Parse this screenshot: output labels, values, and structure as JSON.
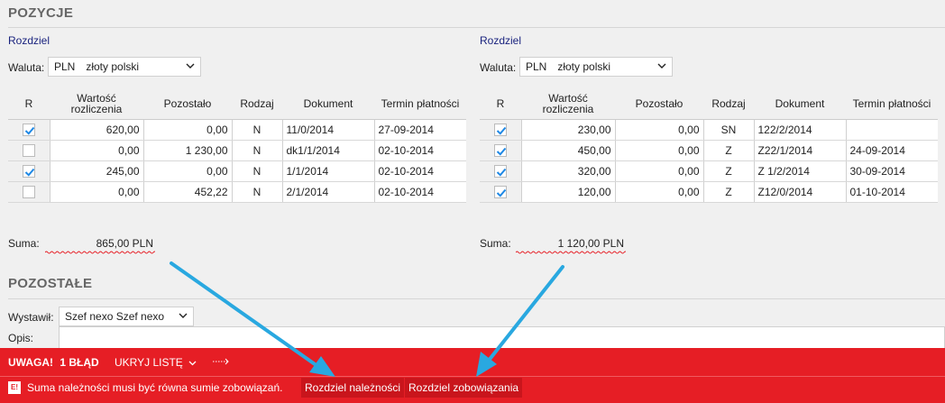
{
  "sections": {
    "pozycje": "POZYCJE",
    "pozostale": "POZOSTAŁE"
  },
  "left": {
    "link": "Rozdziel",
    "currency_label": "Waluta:",
    "currency_code": "PLN",
    "currency_name": "złoty polski",
    "columns": [
      "R",
      "Wartość rozliczenia",
      "Pozostało",
      "Rodzaj",
      "Dokument",
      "Termin płatności"
    ],
    "rows": [
      {
        "checked": true,
        "wartosc": "620,00",
        "pozostalo": "0,00",
        "rodzaj": "N",
        "dokument": "11/0/2014",
        "termin": "27-09-2014"
      },
      {
        "checked": false,
        "wartosc": "0,00",
        "pozostalo": "1 230,00",
        "rodzaj": "N",
        "dokument": "dk1/1/2014",
        "termin": "02-10-2014"
      },
      {
        "checked": true,
        "wartosc": "245,00",
        "pozostalo": "0,00",
        "rodzaj": "N",
        "dokument": "1/1/2014",
        "termin": "02-10-2014"
      },
      {
        "checked": false,
        "wartosc": "0,00",
        "pozostalo": "452,22",
        "rodzaj": "N",
        "dokument": "2/1/2014",
        "termin": "02-10-2014"
      }
    ],
    "suma_label": "Suma:",
    "suma_value": "865,00 PLN"
  },
  "right": {
    "link": "Rozdziel",
    "currency_label": "Waluta:",
    "currency_code": "PLN",
    "currency_name": "złoty polski",
    "columns": [
      "R",
      "Wartość rozliczenia",
      "Pozostało",
      "Rodzaj",
      "Dokument",
      "Termin płatności"
    ],
    "rows": [
      {
        "checked": true,
        "wartosc": "230,00",
        "pozostalo": "0,00",
        "rodzaj": "SN",
        "dokument": "122/2/2014",
        "termin": ""
      },
      {
        "checked": true,
        "wartosc": "450,00",
        "pozostalo": "0,00",
        "rodzaj": "Z",
        "dokument": "Z22/1/2014",
        "termin": "24-09-2014"
      },
      {
        "checked": true,
        "wartosc": "320,00",
        "pozostalo": "0,00",
        "rodzaj": "Z",
        "dokument": "Z 1/2/2014",
        "termin": "30-09-2014"
      },
      {
        "checked": true,
        "wartosc": "120,00",
        "pozostalo": "0,00",
        "rodzaj": "Z",
        "dokument": "Z12/0/2014",
        "termin": "01-10-2014"
      }
    ],
    "suma_label": "Suma:",
    "suma_value": "1 120,00 PLN"
  },
  "pozostale": {
    "wystawil_label": "Wystawił:",
    "wystawil_value": "Szef nexo Szef nexo",
    "opis_label": "Opis:"
  },
  "error_bar": {
    "warning": "UWAGA!",
    "count": "1 BŁĄD",
    "hide_list": "UKRYJ LISTĘ",
    "badge": "E!",
    "message": "Suma należności musi być równa sumie zobowiązań.",
    "button_receivables": "Rozdziel należności",
    "button_liabilities": "Rozdziel zobowiązania"
  },
  "colors": {
    "error_bg": "#e61e25",
    "link": "#1a237e",
    "check": "#1e88e5",
    "annotation_arrow": "#29a8e0"
  }
}
